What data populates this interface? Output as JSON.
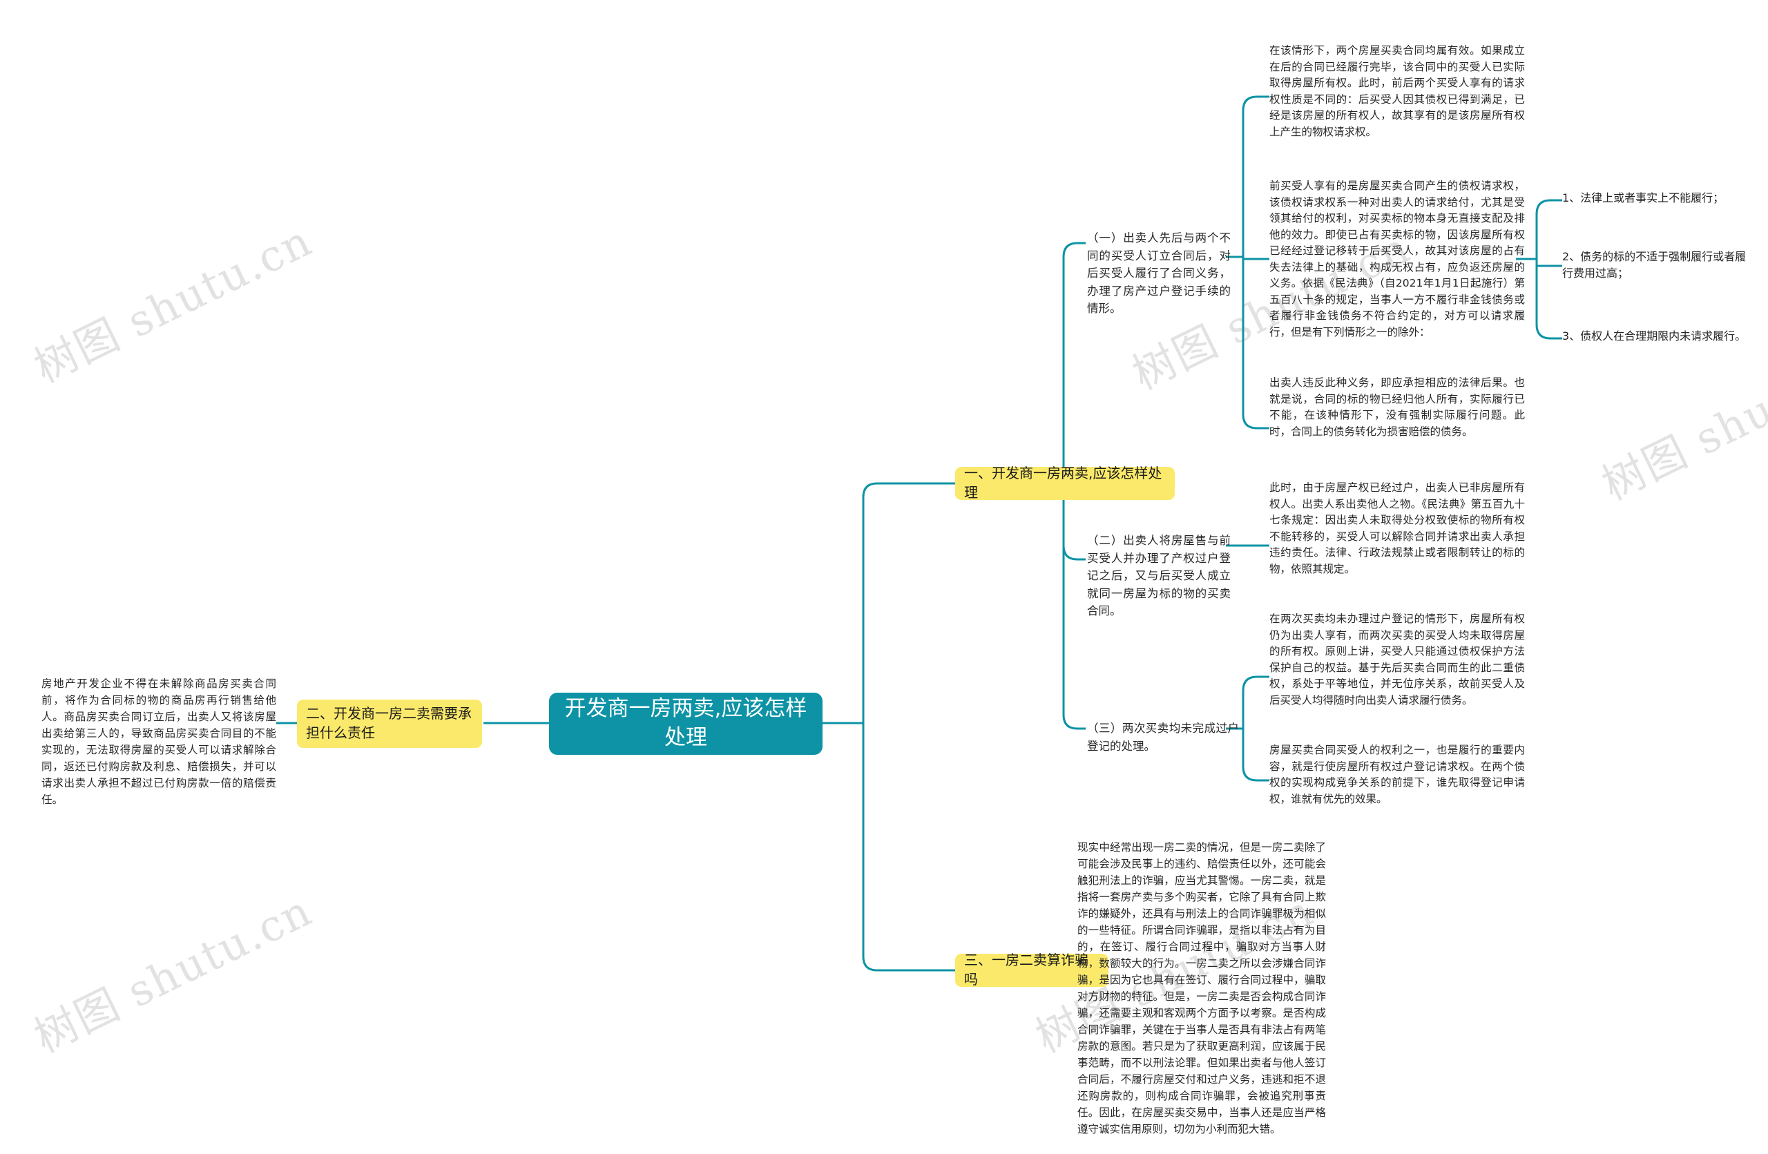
{
  "meta": {
    "accent_teal": "#0d93a5",
    "accent_yellow": "#fbe96b",
    "text_color": "#262626",
    "watermark_text": "树图 shutu.cn"
  },
  "root": {
    "label": "开发商一房两卖,应该怎样处理"
  },
  "topics": [
    {
      "id": "t1",
      "label": "一、开发商一房两卖,应该怎样处理"
    },
    {
      "id": "t2",
      "label": "二、开发商一房二卖需要承担什么责任"
    },
    {
      "id": "t3",
      "label": "三、一房二卖算诈骗吗"
    }
  ],
  "topic1_subs": [
    {
      "id": "s1",
      "label": "（一）出卖人先后与两个不同的买受人订立合同后，对后买受人履行了合同义务，办理了房产过户登记手续的情形。"
    },
    {
      "id": "s2",
      "label": "（二）出卖人将房屋售与前买受人并办理了产权过户登记之后，又与后买受人成立就同一房屋为标的物的买卖合同。"
    },
    {
      "id": "s3",
      "label": "（三）两次买卖均未完成过户登记的处理。"
    }
  ],
  "details": [
    {
      "id": "d1",
      "parent": "s1",
      "text": "在该情形下，两个房屋买卖合同均属有效。如果成立在后的合同已经履行完毕，该合同中的买受人已实际取得房屋所有权。此时，前后两个买受人享有的请求权性质是不同的：后买受人因其债权已得到满足，已经是该房屋的所有权人，故其享有的是该房屋所有权上产生的物权请求权。"
    },
    {
      "id": "d2",
      "parent": "s1",
      "text": "前买受人享有的是房屋买卖合同产生的债权请求权，该债权请求权系一种对出卖人的请求给付，尤其是受领其给付的权利，对买卖标的物本身无直接支配及排他的效力。即使已占有买卖标的物，因该房屋所有权已经经过登记移转于后买受人，故其对该房屋的占有失去法律上的基础，构成无权占有，应负返还房屋的义务。依据《民法典》（自2021年1月1日起施行）第五百八十条的规定，当事人一方不履行非金钱债务或者履行非金钱债务不符合约定的，对方可以请求履行，但是有下列情形之一的除外："
    },
    {
      "id": "d3",
      "parent": "s1",
      "text": "出卖人违反此种义务，即应承担相应的法律后果。也就是说，合同的标的物已经归他人所有，实际履行已不能，在该种情形下，没有强制实际履行问题。此时，合同上的债务转化为损害赔偿的债务。"
    },
    {
      "id": "d4",
      "parent": "s2",
      "text": "此时，由于房屋产权已经过户，出卖人已非房屋所有权人。出卖人系出卖他人之物。《民法典》第五百九十七条规定：因出卖人未取得处分权致使标的物所有权不能转移的，买受人可以解除合同并请求出卖人承担违约责任。法律、行政法规禁止或者限制转让的标的物，依照其规定。"
    },
    {
      "id": "d5",
      "parent": "s3",
      "text": "在两次买卖均未办理过户登记的情形下，房屋所有权仍为出卖人享有，而两次买卖的买受人均未取得房屋的所有权。原则上讲，买受人只能通过债权保护方法保护自己的权益。基于先后买卖合同而生的此二重债权，系处于平等地位，并无位序关系，故前买受人及后买受人均得随时向出卖人请求履行债务。"
    },
    {
      "id": "d6",
      "parent": "s3",
      "text": "房屋买卖合同买受人的权利之一，也是履行的重要内容，就是行使房屋所有权过户登记请求权。在两个债权的实现构成竞争关系的前提下，谁先取得登记申请权，谁就有优先的效果。"
    }
  ],
  "exception_items": [
    {
      "id": "e1",
      "label": "1、法律上或者事实上不能履行；"
    },
    {
      "id": "e2",
      "label": "2、债务的标的不适于强制履行或者履行费用过高；"
    },
    {
      "id": "e3",
      "label": "3、债权人在合理期限内未请求履行。"
    }
  ],
  "topic2_detail": {
    "id": "d7",
    "text": "房地产开发企业不得在未解除商品房买卖合同前，将作为合同标的物的商品房再行销售给他人。商品房买卖合同订立后，出卖人又将该房屋出卖给第三人的，导致商品房买卖合同目的不能实现的，无法取得房屋的买受人可以请求解除合同，返还已付购房款及利息、赔偿损失，并可以请求出卖人承担不超过已付购房款一倍的赔偿责任。"
  },
  "topic3_detail": {
    "id": "d8",
    "text": "现实中经常出现一房二卖的情况，但是一房二卖除了可能会涉及民事上的违约、赔偿责任以外，还可能会触犯刑法上的诈骗，应当尤其警惕。一房二卖，就是指将一套房产卖与多个购买者，它除了具有合同上欺诈的嫌疑外，还具有与刑法上的合同诈骗罪极为相似的一些特征。所谓合同诈骗罪，是指以非法占有为目的，在签订、履行合同过程中，骗取对方当事人财物，数额较大的行为。一房二卖之所以会涉嫌合同诈骗，是因为它也具有在签订、履行合同过程中，骗取对方财物的特征。但是，一房二卖是否会构成合同诈骗，还需要主观和客观两个方面予以考察。是否构成合同诈骗罪，关键在于当事人是否具有非法占有两笔房款的意图。若只是为了获取更高利润，应该属于民事范畴，而不以刑法论罪。但如果出卖者与他人签订合同后，不履行房屋交付和过户义务，违逃和拒不退还购房款的，则构成合同诈骗罪，会被追究刑事责任。因此，在房屋买卖交易中，当事人还是应当严格遵守诚实信用原则，切勿为小利而犯大错。"
  }
}
